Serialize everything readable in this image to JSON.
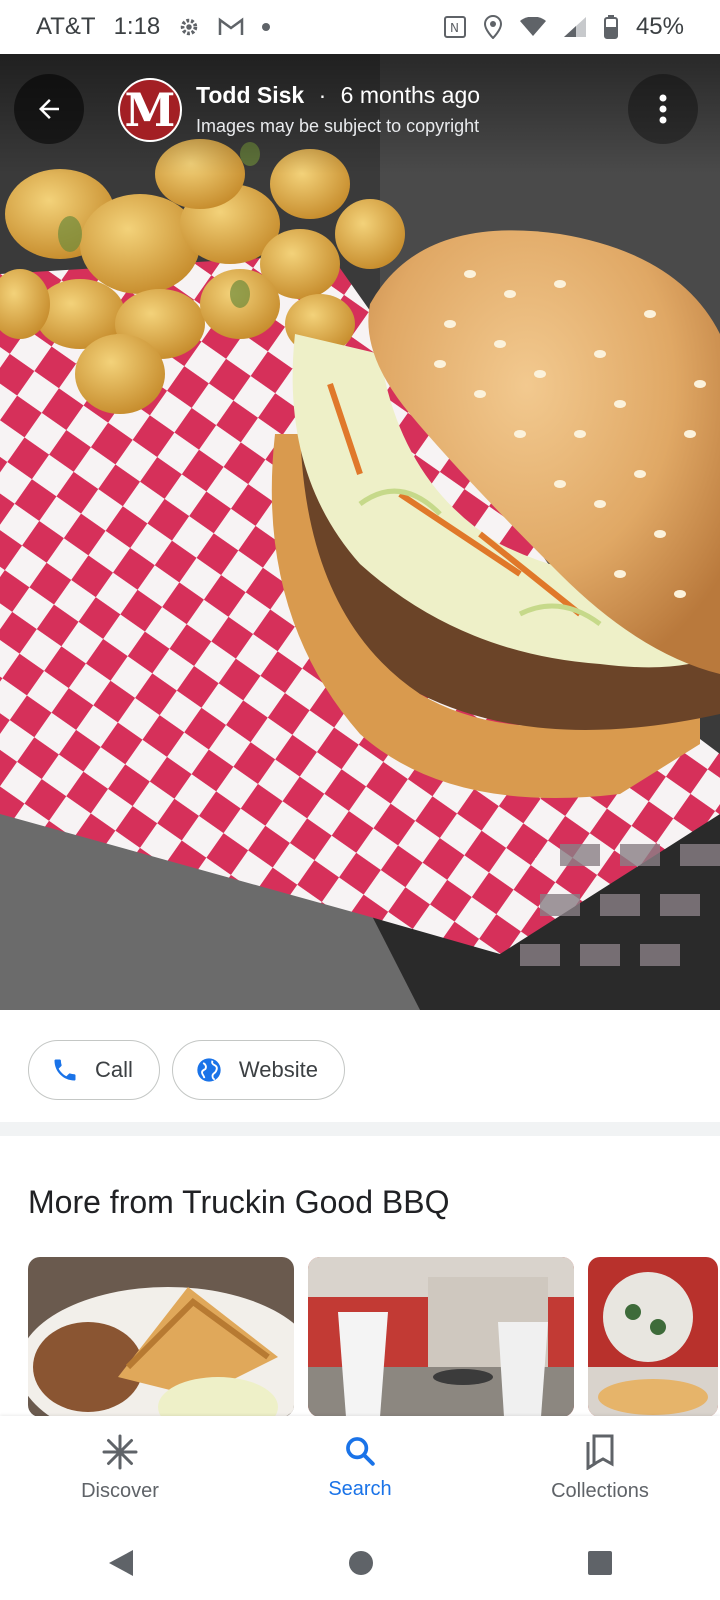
{
  "status_bar": {
    "carrier": "AT&T",
    "time": "1:18",
    "battery": "45%",
    "icons_left": [
      "settings-icon",
      "gmail-icon",
      "dot-icon"
    ],
    "icons_right": [
      "nfc-icon",
      "location-icon",
      "wifi-icon",
      "signal-icon",
      "battery-icon"
    ]
  },
  "photo_header": {
    "author_name": "Todd Sisk",
    "separator": "·",
    "posted": "6 months ago",
    "copyright_note": "Images may be subject to copyright",
    "avatar_letter": "M"
  },
  "actions": {
    "call_label": "Call",
    "website_label": "Website"
  },
  "section": {
    "title": "More from Truckin Good BBQ"
  },
  "bottom_nav": {
    "items": [
      {
        "label": "Discover",
        "icon": "sparkle-icon"
      },
      {
        "label": "Search",
        "icon": "search-icon",
        "active": true
      },
      {
        "label": "Collections",
        "icon": "collections-icon"
      }
    ]
  },
  "colors": {
    "accent": "#1a73e8",
    "avatar_bg": "#a31f24"
  }
}
